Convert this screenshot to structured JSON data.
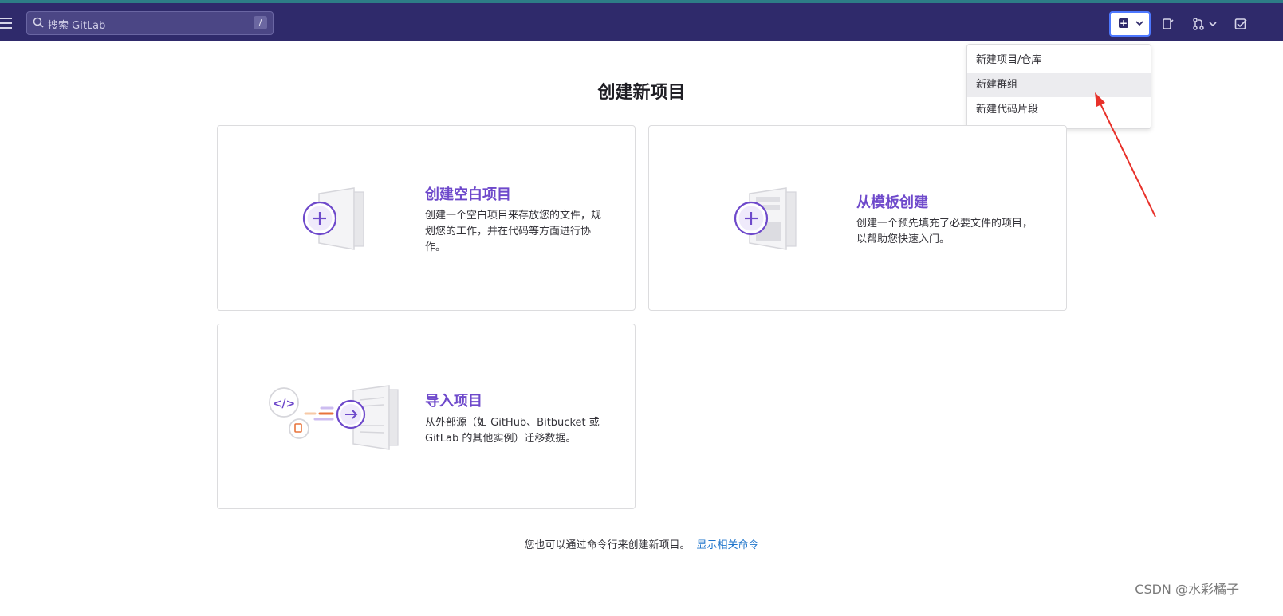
{
  "topbar": {
    "search_placeholder": "搜索 GitLab",
    "search_shortcut": "/"
  },
  "new_menu": {
    "items": [
      {
        "label": "新建项目/仓库"
      },
      {
        "label": "新建群组"
      },
      {
        "label": "新建代码片段"
      }
    ]
  },
  "page": {
    "title": "创建新项目",
    "cards": [
      {
        "heading": "创建空白项目",
        "description": "创建一个空白项目来存放您的文件，规划您的工作，并在代码等方面进行协作。"
      },
      {
        "heading": "从模板创建",
        "description": "创建一个预先填充了必要文件的项目，以帮助您快速入门。"
      },
      {
        "heading": "导入项目",
        "description": "从外部源（如 GitHub、Bitbucket 或 GitLab 的其他实例）迁移数据。"
      }
    ],
    "footer_text": "您也可以通过命令行来创建新项目。",
    "footer_link": "显示相关命令"
  },
  "watermark": "CSDN @水彩橘子",
  "colors": {
    "topbar": "#2f2a6b",
    "accent": "#6e49cb",
    "link": "#1f75cb",
    "annotation_arrow": "#e8312a"
  }
}
